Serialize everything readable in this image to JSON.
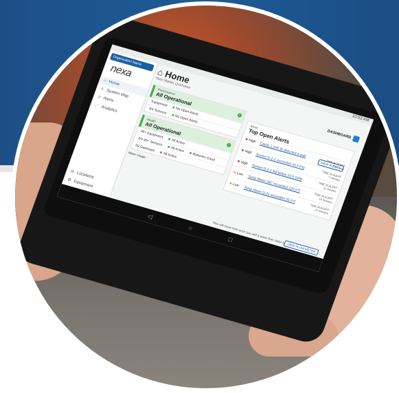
{
  "org_badge": "Organization Name",
  "logo": "nexa",
  "sidebar": {
    "items": [
      {
        "label": "Home"
      },
      {
        "label": "System Map"
      },
      {
        "label": "Alerts"
      },
      {
        "label": "Analytics"
      }
    ],
    "bottom": [
      {
        "label": "Locations"
      },
      {
        "label": "Equipment"
      }
    ]
  },
  "status_time": "10:53 AM",
  "page": {
    "title": "Home",
    "subtitle": "Your Martin Overview",
    "dashboard_label": "DASHBOARD"
  },
  "performance": {
    "label": "Performance",
    "status": "All Operational",
    "rows": [
      {
        "left": "Equipment",
        "right": "No Open Alerts"
      },
      {
        "left": "3/4 Sensors",
        "right": "No Open Alerts"
      }
    ]
  },
  "health": {
    "label": "Health",
    "status": "All Operational",
    "rows": [
      {
        "left": "36+ Equipment",
        "right": "All Active"
      },
      {
        "left": "3/4 99+ Sensors",
        "mid": "All Active",
        "right": "Batteries Good"
      },
      {
        "left": "09 Gateways",
        "right": "All Active"
      }
    ],
    "meter_label": "Meter Usage"
  },
  "alerts": {
    "label": "Alerts",
    "title": "Top Open Alerts",
    "view_button": "VIEW ALERTS",
    "items": [
      {
        "severity": "High",
        "text": "Cavity 1 (HR 9) detected a leak",
        "time_label": "TIME IN ALERT",
        "time": "2 minutes",
        "color": "#d93b3b"
      },
      {
        "severity": "High",
        "text": "Sensor D-2-1 exceeded 40.0 PSI",
        "time_label": "TIME IN ALERT",
        "time": "7 minutes",
        "color": "#d93b3b"
      },
      {
        "severity": "High",
        "text": "Sensor D-2-1 fell below 34.0 GPM",
        "time_label": "TIME IN ALERT",
        "time": "11 minutes",
        "color": "#d93b3b"
      },
      {
        "severity": "Low",
        "text": "Temp Meter 33C exceeded 120.0°F",
        "time_label": "TIME IN ALERT",
        "time": "16 minutes",
        "color": "#f0a030"
      },
      {
        "severity": "Low",
        "text": "Temp Meter D-21 exceeded 25.0°F",
        "time_label": "TIME IN ALERT",
        "time": "21 minutes",
        "color": "#f0a030"
      }
    ]
  },
  "footer_note": "Tiles will show here once you add a water flow meter to your system.",
  "flow_button": "VIEW FLOW METER",
  "colors": {
    "brand_blue": "#1d5fa3",
    "ok_green": "#3fae4a",
    "high_red": "#d93b3b",
    "low_orange": "#f0a030"
  }
}
